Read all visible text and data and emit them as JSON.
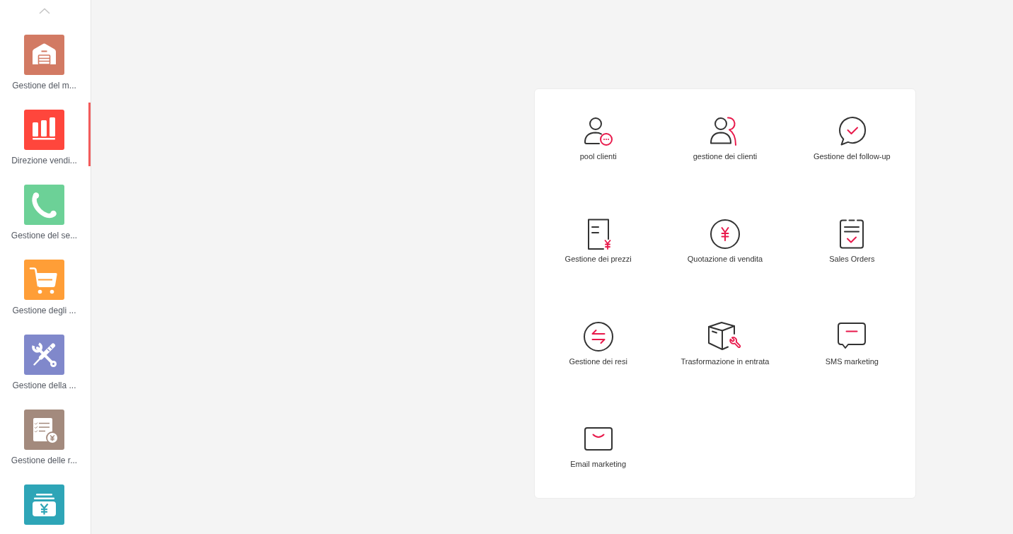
{
  "sidebar": {
    "items": [
      {
        "kind": "warehouse",
        "color": "#d27a63",
        "label": "Gestione del m...",
        "selected": false
      },
      {
        "kind": "bar-chart",
        "color": "#ff463c",
        "label": "Direzione vendi...",
        "selected": true
      },
      {
        "kind": "phone",
        "color": "#6cd197",
        "label": "Gestione del se...",
        "selected": false
      },
      {
        "kind": "cart",
        "color": "#ff9e37",
        "label": "Gestione degli ...",
        "selected": false
      },
      {
        "kind": "tools",
        "color": "#8088cb",
        "label": "Gestione della ...",
        "selected": false
      },
      {
        "kind": "document",
        "color": "#a38a7d",
        "label": "Gestione delle r...",
        "selected": false
      },
      {
        "kind": "money",
        "color": "#2ea5b7",
        "selected": false
      }
    ]
  },
  "modules": [
    {
      "kind": "person-badge",
      "label": "pool clienti"
    },
    {
      "kind": "people",
      "label": "gestione dei clienti"
    },
    {
      "kind": "chat-check",
      "label": "Gestione del follow-up"
    },
    {
      "kind": "document-yen",
      "label": "Gestione dei prezzi"
    },
    {
      "kind": "yen-circle",
      "label": "Quotazione di vendita"
    },
    {
      "kind": "clipboard",
      "label": "Sales Orders"
    },
    {
      "kind": "exchange",
      "label": "Gestione dei resi"
    },
    {
      "kind": "box-wrench",
      "label": "Trasformazione in entrata"
    },
    {
      "kind": "message",
      "label": "SMS marketing"
    },
    {
      "kind": "envelope",
      "label": "Email marketing"
    }
  ]
}
